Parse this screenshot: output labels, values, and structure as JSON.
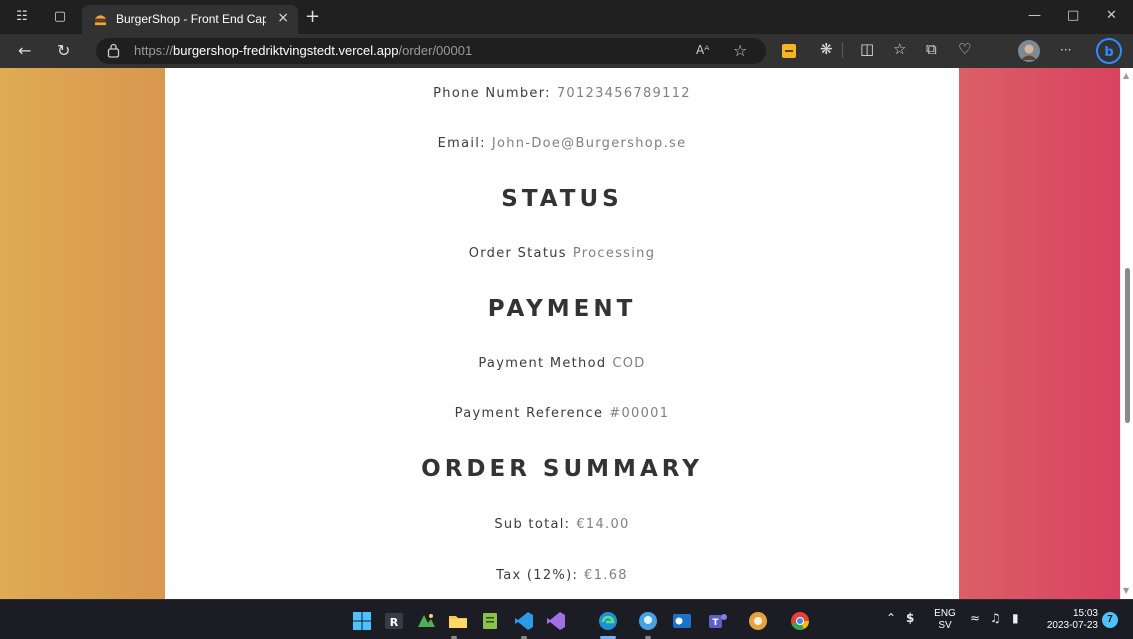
{
  "browser": {
    "tab_title": "BurgerShop - Front End Capstone",
    "tab_close": "×",
    "new_tab": "+",
    "url_prefix": "https://",
    "url_host": "burgershop-fredriktvingstedt.vercel.app",
    "url_path": "/order/00001",
    "read_aloud_label": "Aᴬ",
    "more_label": "···"
  },
  "order": {
    "phone_label": "Phone Number:",
    "phone_value": "70123456789112",
    "email_label": "Email:",
    "email_value": "John-Doe@Burgershop.se",
    "status_heading": "STATUS",
    "order_status_label": "Order Status",
    "order_status_value": "Processing",
    "payment_heading": "PAYMENT",
    "payment_method_label": "Payment Method",
    "payment_method_value": "COD",
    "payment_reference_label": "Payment Reference",
    "payment_reference_value": "#00001",
    "summary_heading": "ORDER SUMMARY",
    "subtotal_label": "Sub total:",
    "subtotal_value": "€14.00",
    "tax_label": "Tax (12%):",
    "tax_value": "€1.68"
  },
  "taskbar": {
    "lang_top": "ENG",
    "lang_bottom": "SV",
    "time": "15:03",
    "date": "2023-07-23",
    "notification_count": "7"
  },
  "colors": {
    "gradient_left": "#e0aa52",
    "gradient_right": "#d9425f",
    "accent": "#0078d4"
  }
}
